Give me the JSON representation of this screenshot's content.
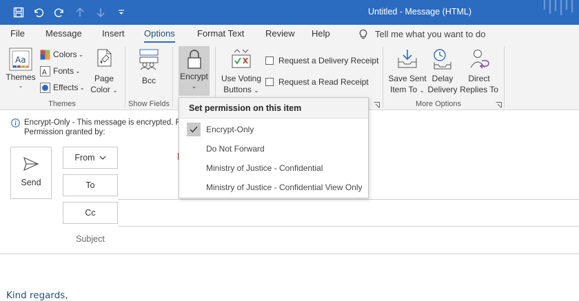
{
  "window": {
    "title": "Untitled  -  Message (HTML)"
  },
  "quick_access": {
    "icons": [
      "save-icon",
      "undo-icon",
      "redo-icon",
      "up-arrow-icon",
      "down-arrow-icon",
      "customize-icon"
    ]
  },
  "tabs": [
    {
      "label": "File"
    },
    {
      "label": "Message"
    },
    {
      "label": "Insert"
    },
    {
      "label": "Options",
      "active": true
    },
    {
      "label": "Format Text"
    },
    {
      "label": "Review"
    },
    {
      "label": "Help"
    }
  ],
  "tell_me": "Tell me what you want to do",
  "ribbon": {
    "themes": {
      "themes_label": "Themes",
      "colors_label": "Colors",
      "fonts_label": "Fonts",
      "effects_label": "Effects",
      "page_color_line1": "Page",
      "page_color_line2": "Color",
      "group_label": "Themes"
    },
    "show_fields": {
      "bcc_label": "Bcc",
      "group_label": "Show Fields"
    },
    "encrypt_label": "Encrypt",
    "tracking": {
      "voting_line1": "Use Voting",
      "voting_line2": "Buttons",
      "delivery_receipt": "Request a Delivery Receipt",
      "read_receipt": "Request a Read Receipt"
    },
    "more_options": {
      "save_sent_line1": "Save Sent",
      "save_sent_line2": "Item To",
      "delay_line1": "Delay",
      "delay_line2": "Delivery",
      "direct_line1": "Direct",
      "direct_line2": "Replies To",
      "group_label": "More Options"
    }
  },
  "info_bar": {
    "line1": "Encrypt-Only - This message is encrypted. Re",
    "line2": "Permission granted by:"
  },
  "compose": {
    "send_label": "Send",
    "from_label": "From",
    "to_label": "To",
    "cc_label": "Cc",
    "subject_label": "Subject",
    "body_signature": "Kind regards,"
  },
  "permission_menu": {
    "header": "Set permission on this item",
    "items": [
      {
        "label": "Encrypt-Only",
        "checked": true
      },
      {
        "label": "Do Not Forward",
        "checked": false
      },
      {
        "label": "Ministry of Justice - Confidential",
        "checked": false
      },
      {
        "label": "Ministry of Justice - Confidential View Only",
        "checked": false
      }
    ]
  },
  "colors": {
    "title_bar": "#2b6bc0",
    "ribbon_bg": "#f3f3f3",
    "accent": "#2b6bc0",
    "signature_text": "#1f4e79"
  }
}
